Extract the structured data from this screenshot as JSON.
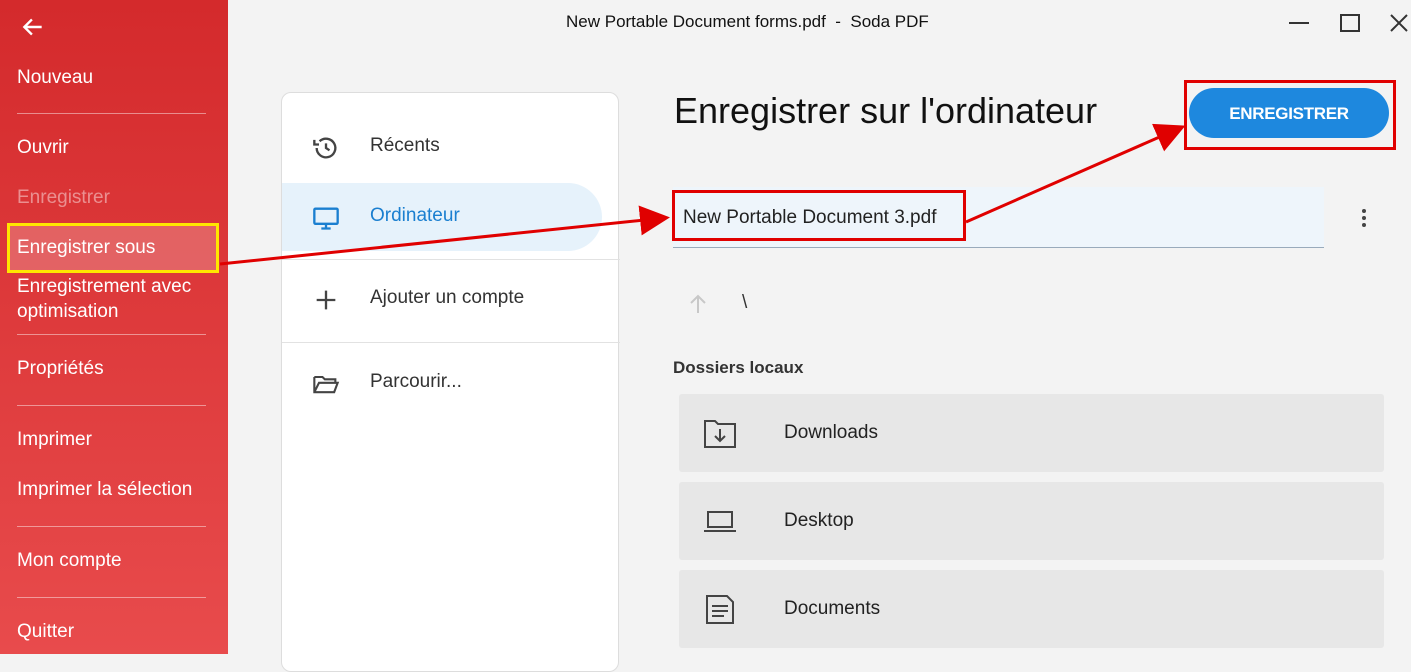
{
  "window": {
    "title": "New Portable Document forms.pdf  -  Soda PDF",
    "controls": [
      "minimize-icon",
      "maximize-icon",
      "close-icon"
    ]
  },
  "sidebar": {
    "back_icon": "arrow-left-icon",
    "items": [
      {
        "label": "Nouveau"
      },
      {
        "label": "Ouvrir"
      },
      {
        "label": "Enregistrer",
        "disabled": true
      },
      {
        "label": "Enregistrer sous",
        "active": true
      },
      {
        "label": "Enregistrement avec optimisation"
      },
      {
        "label": "Propriétés"
      },
      {
        "label": "Imprimer"
      },
      {
        "label": "Imprimer la sélection"
      },
      {
        "label": "Mon compte"
      },
      {
        "label": "Quitter"
      }
    ],
    "line4a": "Enregistrement avec",
    "line4b": "optimisation"
  },
  "locations": {
    "items": [
      {
        "label": "Récents",
        "icon": "history-icon"
      },
      {
        "label": "Ordinateur",
        "icon": "monitor-icon",
        "selected": true
      },
      {
        "label": "Ajouter un compte",
        "icon": "plus-icon"
      },
      {
        "label": "Parcourir...",
        "icon": "folder-open-icon"
      }
    ]
  },
  "main": {
    "heading": "Enregistrer sur l'ordinateur",
    "save_label": "ENREGISTRER",
    "filename": "New Portable Document 3.pdf",
    "path": "\\",
    "section_title": "Dossiers locaux",
    "folders": [
      {
        "label": "Downloads",
        "icon": "folder-download-icon"
      },
      {
        "label": "Desktop",
        "icon": "laptop-icon"
      },
      {
        "label": "Documents",
        "icon": "document-icon"
      }
    ]
  },
  "colors": {
    "sidebar": "#d42a2c",
    "accent": "#1e88de",
    "highlight_yellow": "#ffe600",
    "annotation_red": "#e00000"
  }
}
